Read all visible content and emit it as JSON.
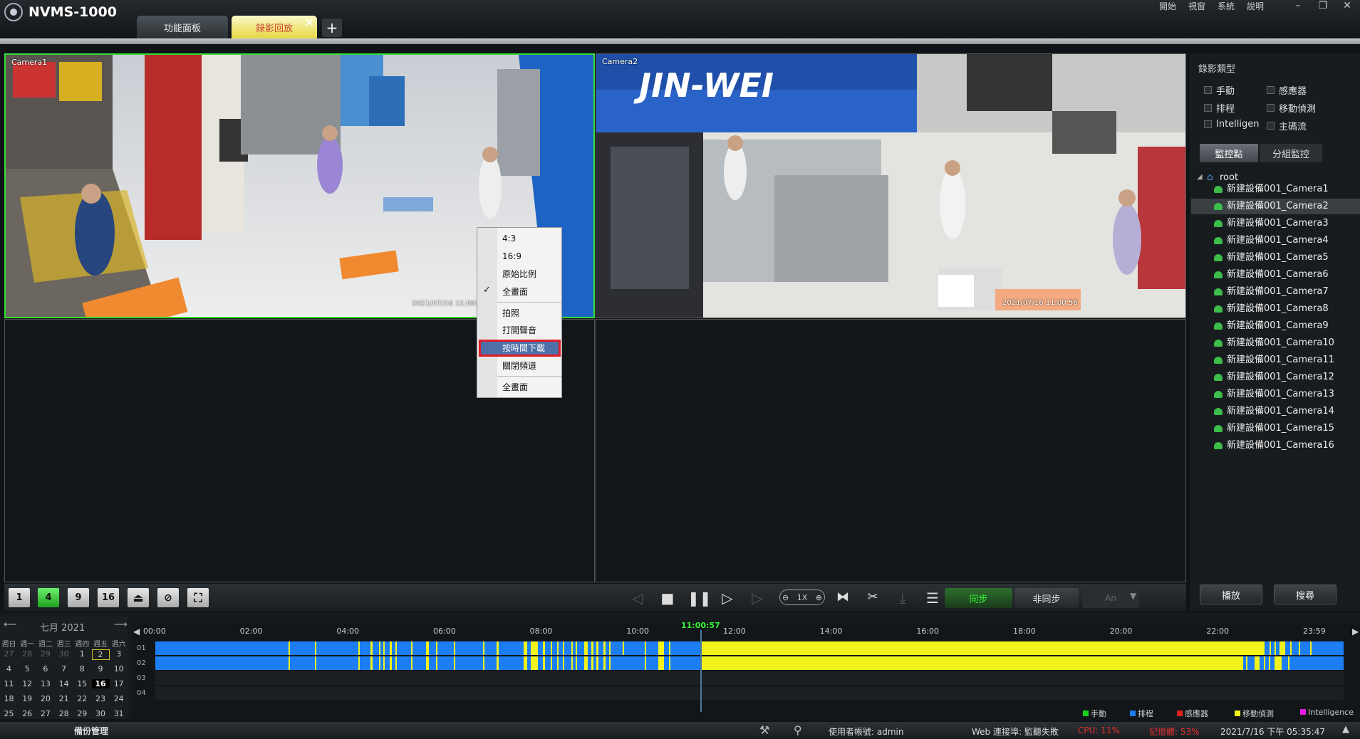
{
  "app": {
    "title": "NVMS-1000"
  },
  "tabs": [
    {
      "label": "功能面板"
    },
    {
      "label": "錄影回放"
    }
  ],
  "tab_close": "×",
  "tab_add": "+",
  "menus": [
    "開始",
    "視窗",
    "系統",
    "說明"
  ],
  "window_buttons": [
    "–",
    "❐",
    "✕"
  ],
  "video": {
    "camera1_label": "Camera1",
    "camera2_label": "Camera2",
    "camera1_timestamp": "2021/07/16 11:00:56",
    "camera2_timestamp": "2021/07/16 11:00:56"
  },
  "context_menu": {
    "items": [
      "4:3",
      "16:9",
      "原始比例",
      "全畫面",
      "拍照",
      "打開聲音",
      "按時間下載",
      "關閉頻道",
      "全畫面"
    ],
    "checked_index": 3,
    "highlighted_index": 6
  },
  "toolbar": {
    "layouts": [
      "1",
      "4",
      "9",
      "16"
    ],
    "speed_label": "1X",
    "sync_label": "同步",
    "async_label": "非同步",
    "dropdown_label": "An"
  },
  "right_panel": {
    "record_type_title": "錄影類型",
    "checkboxes": [
      {
        "label": "手動"
      },
      {
        "label": "感應器"
      },
      {
        "label": "排程"
      },
      {
        "label": "移動偵測"
      },
      {
        "label": "Intelligen"
      },
      {
        "label": "主碼流"
      }
    ],
    "tabs": [
      "監控點",
      "分組監控"
    ],
    "tree_root": "root",
    "cameras": [
      "新建設備001_Camera1",
      "新建設備001_Camera2",
      "新建設備001_Camera3",
      "新建設備001_Camera4",
      "新建設備001_Camera5",
      "新建設備001_Camera6",
      "新建設備001_Camera7",
      "新建設備001_Camera8",
      "新建設備001_Camera9",
      "新建設備001_Camera10",
      "新建設備001_Camera11",
      "新建設備001_Camera12",
      "新建設備001_Camera13",
      "新建設備001_Camera14",
      "新建設備001_Camera15",
      "新建設備001_Camera16"
    ],
    "selected_camera_index": 1,
    "play_label": "播放",
    "search_label": "搜尋"
  },
  "calendar": {
    "month_label": "七月 2021",
    "headers": [
      "週日",
      "週一",
      "週二",
      "週三",
      "週四",
      "週五",
      "週六"
    ],
    "weeks": [
      [
        "27",
        "28",
        "29",
        "30",
        "1",
        "2",
        "3"
      ],
      [
        "4",
        "5",
        "6",
        "7",
        "8",
        "9",
        "10"
      ],
      [
        "11",
        "12",
        "13",
        "14",
        "15",
        "16",
        "17"
      ],
      [
        "18",
        "19",
        "20",
        "21",
        "22",
        "23",
        "24"
      ],
      [
        "25",
        "26",
        "27",
        "28",
        "29",
        "30",
        "31"
      ]
    ],
    "today": "2",
    "selected": "16"
  },
  "timeline": {
    "ticks": [
      "00:00",
      "02:00",
      "04:00",
      "06:00",
      "08:00",
      "10:00",
      "12:00",
      "14:00",
      "16:00",
      "18:00",
      "20:00",
      "22:00",
      "23:59"
    ],
    "cursor_time": "11:00:57",
    "rows": [
      "01",
      "02",
      "03",
      "04"
    ]
  },
  "legend": [
    {
      "label": "手動",
      "color": "#19d119"
    },
    {
      "label": "排程",
      "color": "#1c7ef2"
    },
    {
      "label": "感應器",
      "color": "#e32020"
    },
    {
      "label": "移動偵測",
      "color": "#f2f21c"
    },
    {
      "label": "Intelligence",
      "color": "#e61ce6"
    }
  ],
  "statusbar": {
    "backup_label": "備份管理",
    "user_label": "使用者帳號: admin",
    "web_label": "Web 連接埠: 監聽失敗",
    "cpu_label": "CPU: 11%",
    "mem_label": "記憶體: 53%",
    "datetime": "2021/7/16 下午 05:35:47"
  },
  "colors": {
    "schedule": "#1c7ef2",
    "motion": "#f2f21c",
    "accent_green": "#36f536",
    "highlight_red": "#e21c24"
  }
}
